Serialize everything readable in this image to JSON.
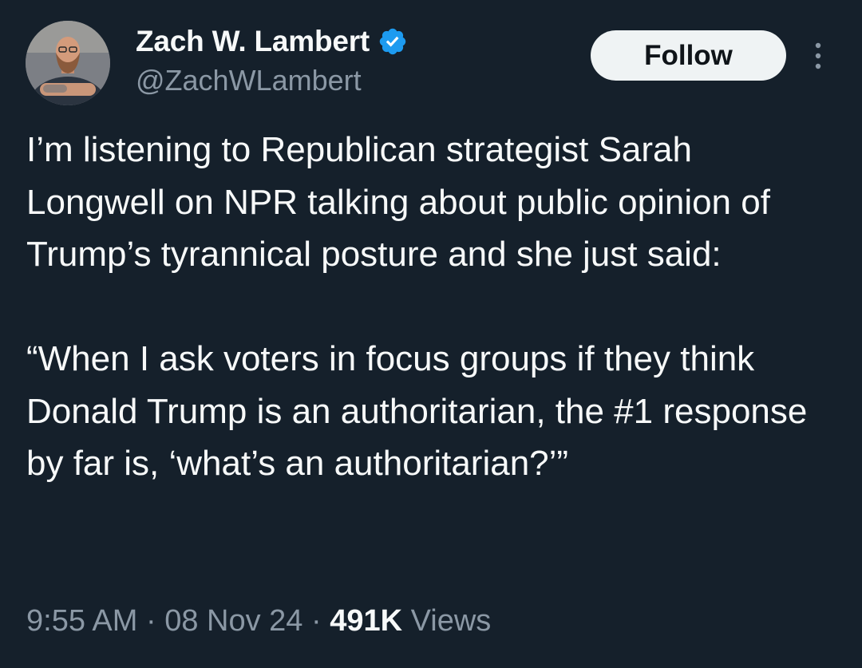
{
  "author": {
    "display_name": "Zach W. Lambert",
    "handle": "@ZachWLambert",
    "verified": true,
    "verified_color": "#1d9bf0"
  },
  "actions": {
    "follow_label": "Follow",
    "more_icon": "more-vertical-icon"
  },
  "tweet": {
    "paragraph_1": "I’m listening to Republican strategist Sarah Longwell on NPR talking about public opinion of Trump’s tyrannical posture and she just said:",
    "paragraph_2": "“When I ask voters in focus groups if they think Donald Trump is an authoritarian, the #1 response by far is, ‘what’s an authoritarian?’”"
  },
  "meta": {
    "time": "9:55 AM",
    "separator_1": " · ",
    "date": "08 Nov 24",
    "separator_2": " · ",
    "views_count": "491K",
    "views_label": " Views"
  },
  "colors": {
    "background": "#15202b",
    "text_primary": "#f7f9f9",
    "text_secondary": "#8b98a5",
    "button_bg": "#eff3f4"
  }
}
